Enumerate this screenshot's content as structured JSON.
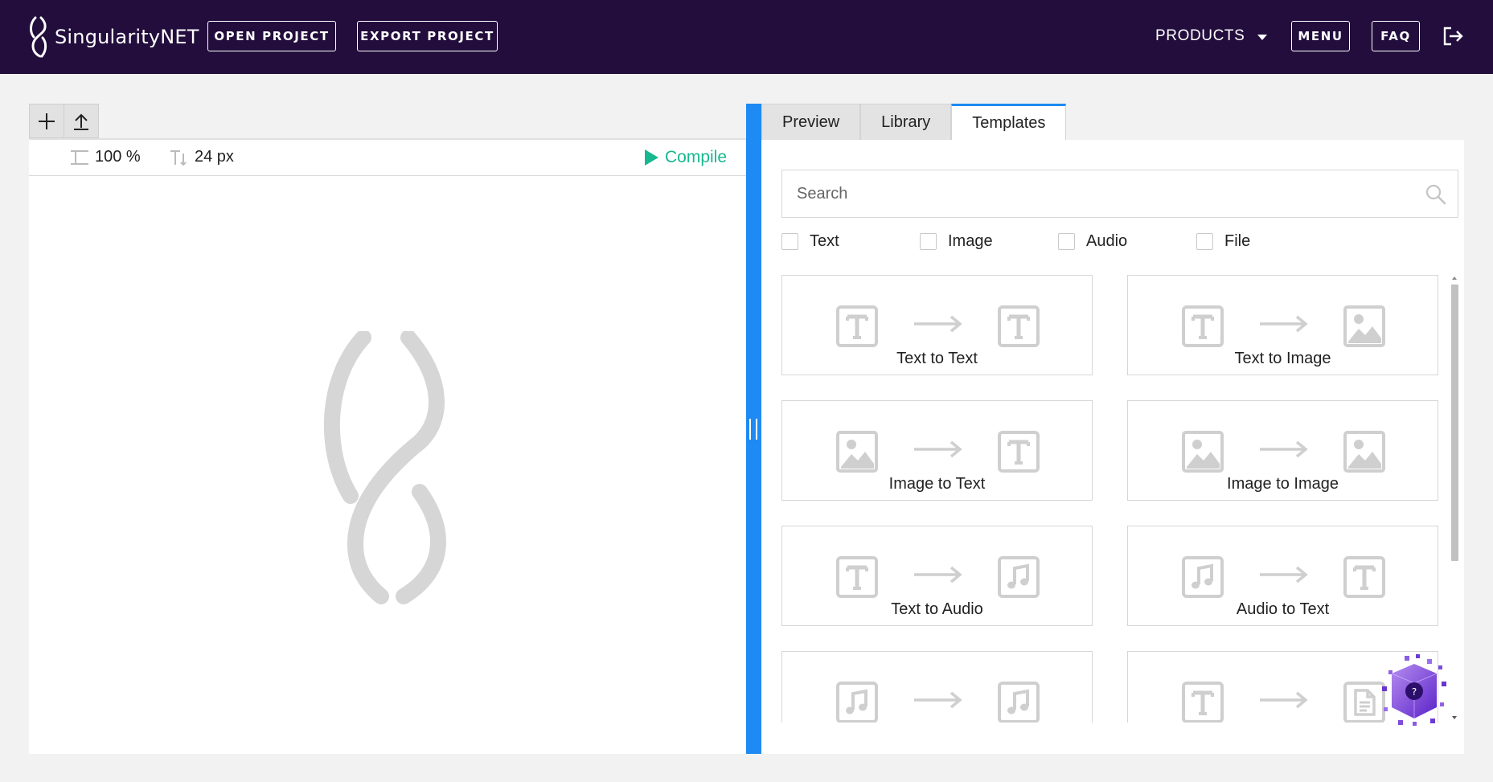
{
  "header": {
    "brand": "SingularityNET",
    "open_project": "OPEN PROJECT",
    "export_project": "EXPORT PROJECT",
    "products": "PRODUCTS",
    "menu": "MENU",
    "faq": "FAQ"
  },
  "editor": {
    "zoom": "100 %",
    "font_size": "24 px",
    "compile": "Compile"
  },
  "tabs": [
    {
      "label": "Preview",
      "active": false
    },
    {
      "label": "Library",
      "active": false
    },
    {
      "label": "Templates",
      "active": true
    }
  ],
  "search": {
    "placeholder": "Search"
  },
  "filters": [
    "Text",
    "Image",
    "Audio",
    "File"
  ],
  "templates": [
    {
      "label": "Text to Text",
      "from": "text-icon",
      "to": "text-icon"
    },
    {
      "label": "Text to Image",
      "from": "text-icon",
      "to": "image-icon"
    },
    {
      "label": "Image to Text",
      "from": "image-icon",
      "to": "text-icon"
    },
    {
      "label": "Image to Image",
      "from": "image-icon",
      "to": "image-icon"
    },
    {
      "label": "Text to Audio",
      "from": "text-icon",
      "to": "audio-icon"
    },
    {
      "label": "Audio to Text",
      "from": "audio-icon",
      "to": "text-icon"
    },
    {
      "label": "",
      "from": "audio-icon",
      "to": "audio-icon"
    },
    {
      "label": "",
      "from": "text-icon",
      "to": "file-icon"
    }
  ],
  "colors": {
    "header_bg": "#220d3c",
    "accent_blue": "#1e8af3",
    "compile_green": "#17b890",
    "icon_gray": "#cfcfcf"
  }
}
